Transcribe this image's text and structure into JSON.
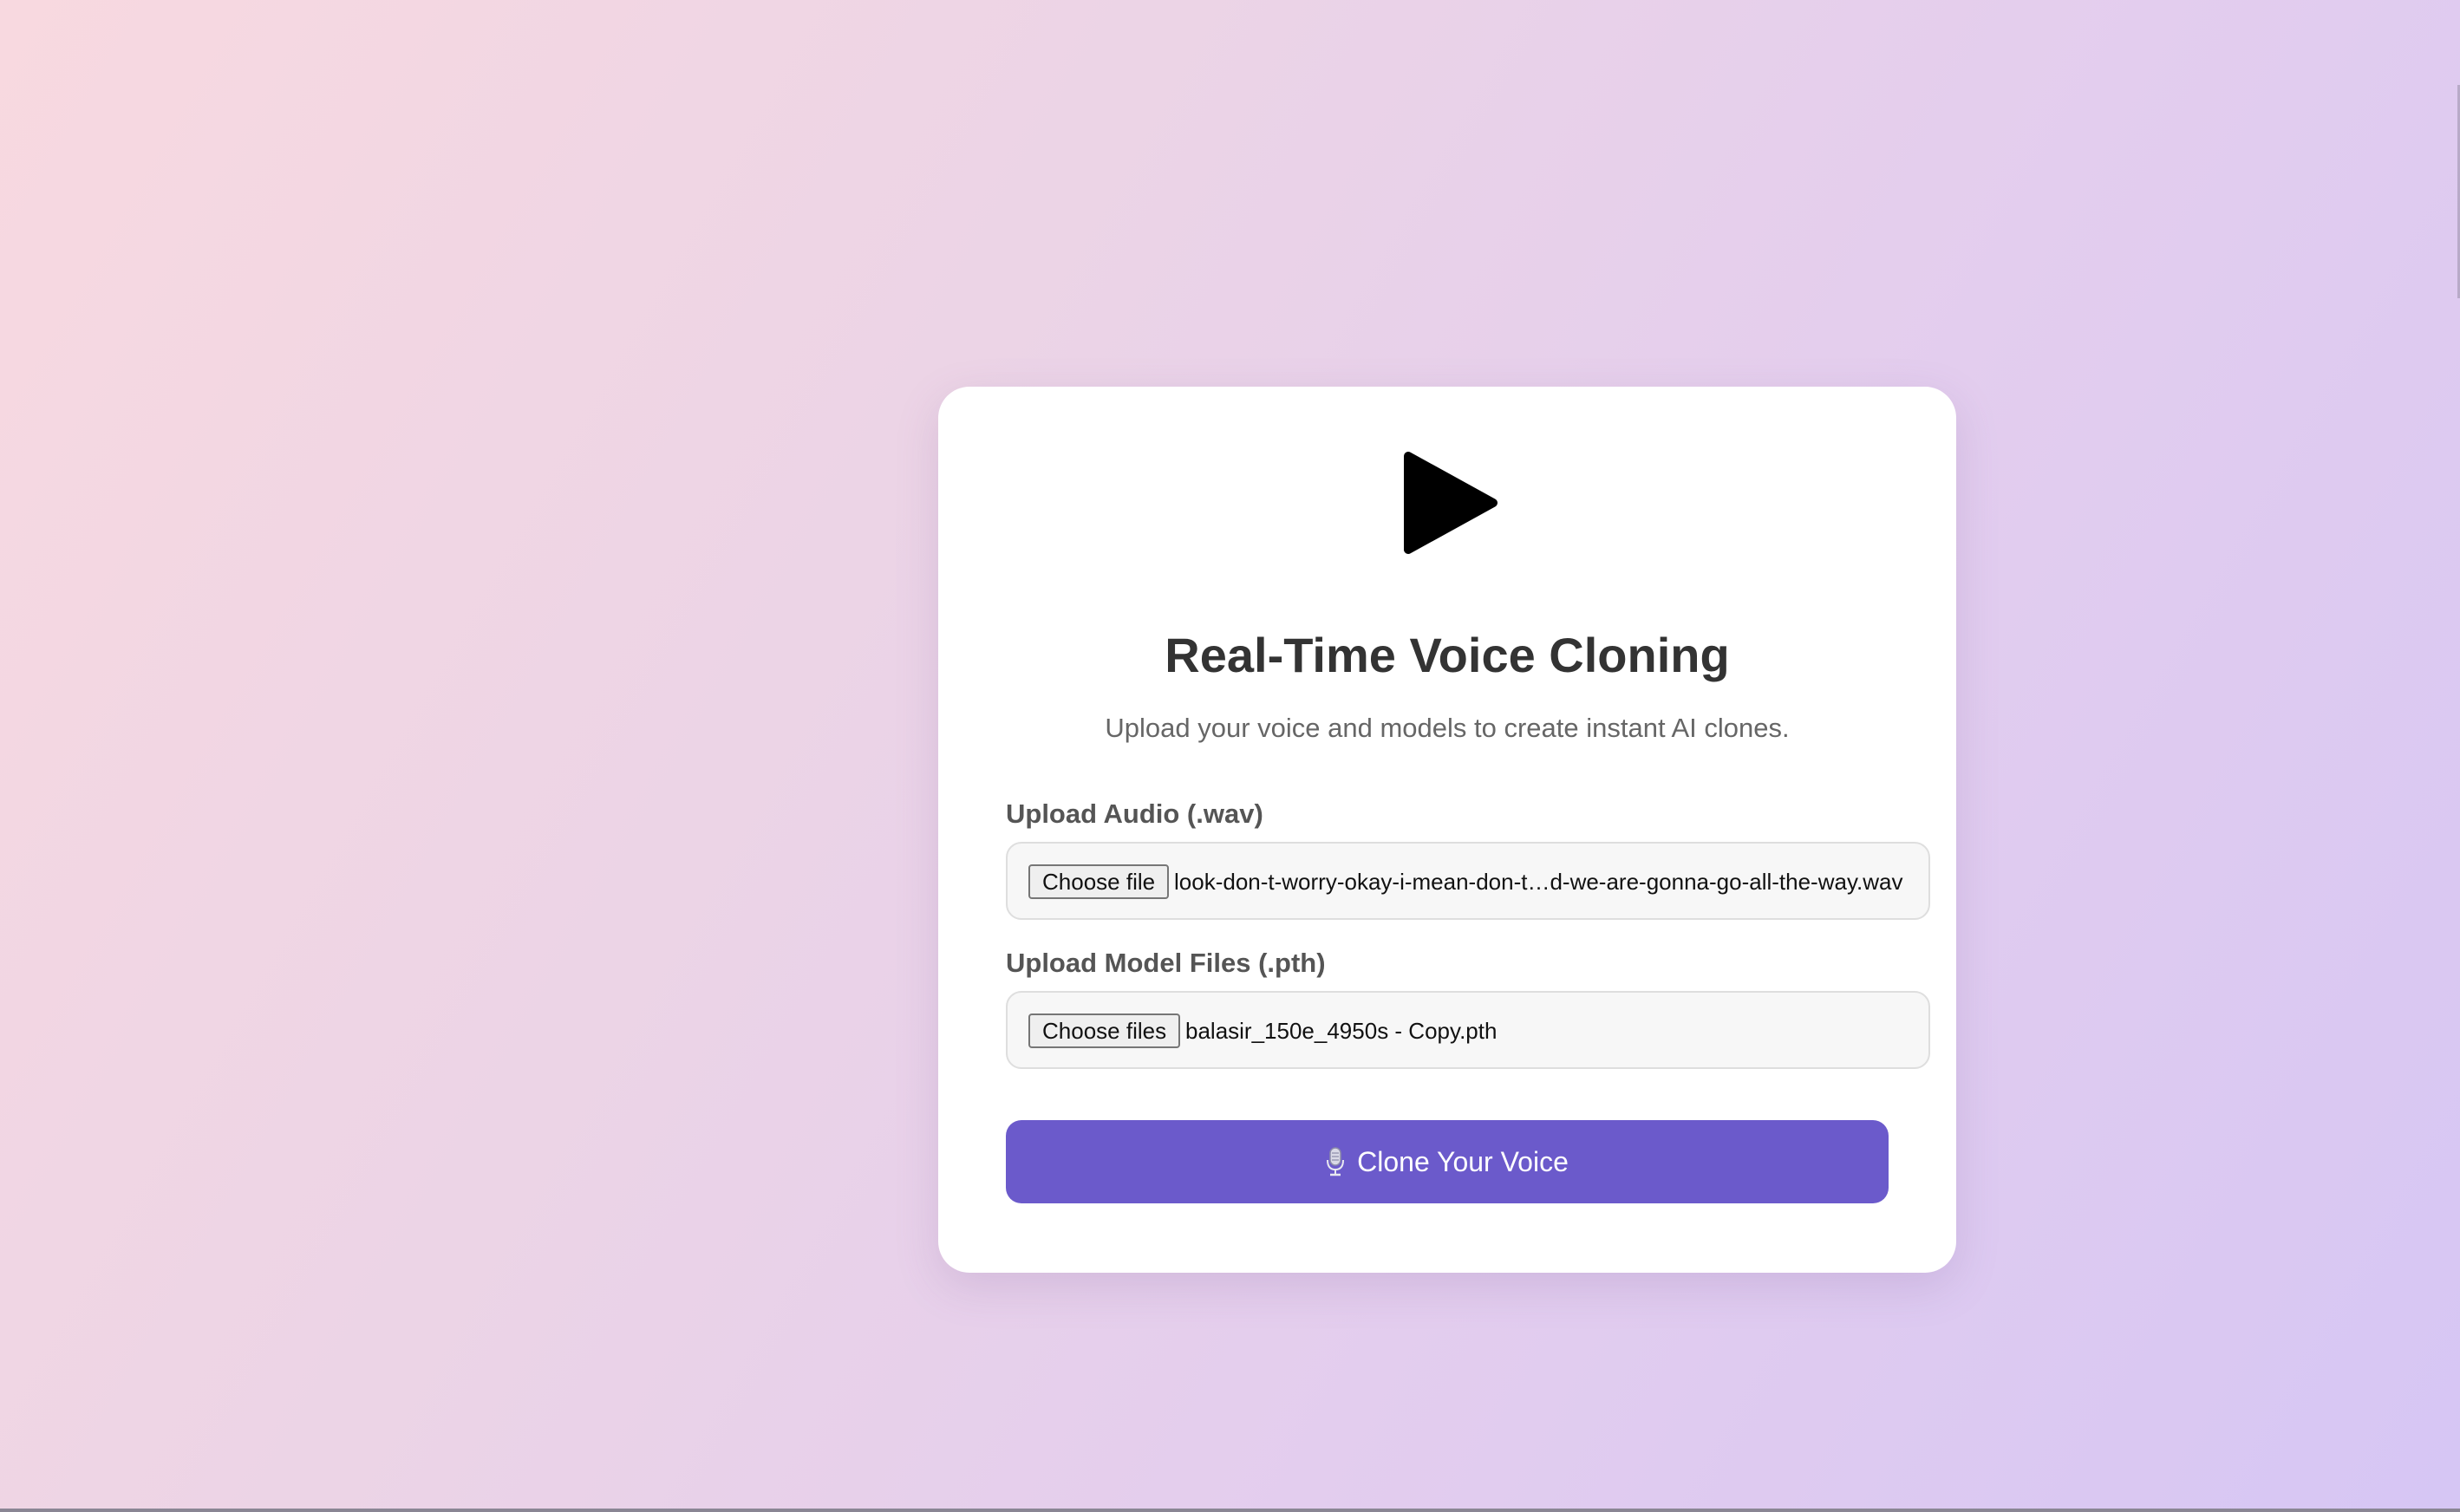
{
  "colors": {
    "accent": "#6b5acb",
    "card": "#ffffff",
    "title": "#333333",
    "subtitle": "#666666"
  },
  "header": {
    "icon": "play-icon",
    "title": "Real-Time Voice Cloning",
    "subtitle": "Upload your voice and models to create instant AI clones."
  },
  "form": {
    "audio": {
      "label": "Upload Audio (.wav)",
      "button_label": "Choose file",
      "file_name": "look-don-t-worry-okay-i-mean-don-t…d-we-are-gonna-go-all-the-way.wav"
    },
    "model": {
      "label": "Upload Model Files (.pth)",
      "button_label": "Choose files",
      "file_name": "balasir_150e_4950s - Copy.pth"
    },
    "submit": {
      "icon": "microphone-icon",
      "label": "Clone Your Voice"
    }
  }
}
